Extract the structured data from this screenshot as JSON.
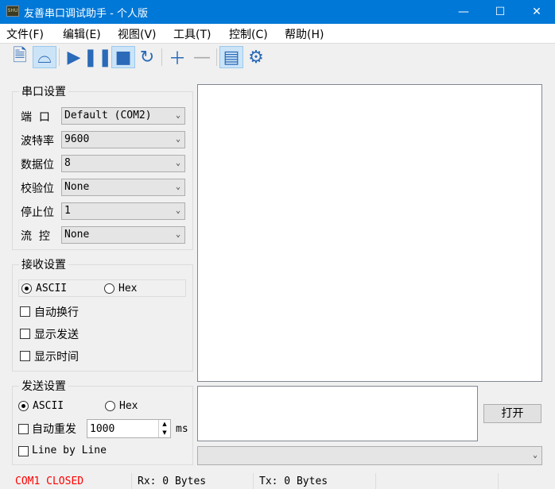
{
  "title": "友善串口调试助手 - 个人版",
  "logo_text": "SHU",
  "window_buttons": {
    "minimize": "—",
    "maximize": "☐",
    "close": "✕"
  },
  "menu": [
    "文件(F)",
    "编辑(E)",
    "视图(V)",
    "工具(T)",
    "控制(C)",
    "帮助(H)"
  ],
  "serial": {
    "title": "串口设置",
    "fields": [
      {
        "label": "端  口",
        "value": "Default (COM2)"
      },
      {
        "label": "波特率",
        "value": "9600"
      },
      {
        "label": "数据位",
        "value": "8"
      },
      {
        "label": "校验位",
        "value": "None"
      },
      {
        "label": "停止位",
        "value": "1"
      },
      {
        "label": "流  控",
        "value": "None"
      }
    ]
  },
  "receive": {
    "title": "接收设置",
    "ascii": "ASCII",
    "hex": "Hex",
    "auto_wrap": "自动换行",
    "show_send": "显示发送",
    "show_time": "显示时间"
  },
  "send": {
    "title": "发送设置",
    "ascii": "ASCII",
    "hex": "Hex",
    "auto_resend": "自动重发",
    "interval": "1000",
    "unit": "ms",
    "line_by_line": "Line by Line"
  },
  "open_button": "打开",
  "status": {
    "port": "COM1 CLOSED",
    "rx": "Rx: 0 Bytes",
    "tx": "Tx: 0 Bytes",
    "port_color": "#ff0000"
  }
}
